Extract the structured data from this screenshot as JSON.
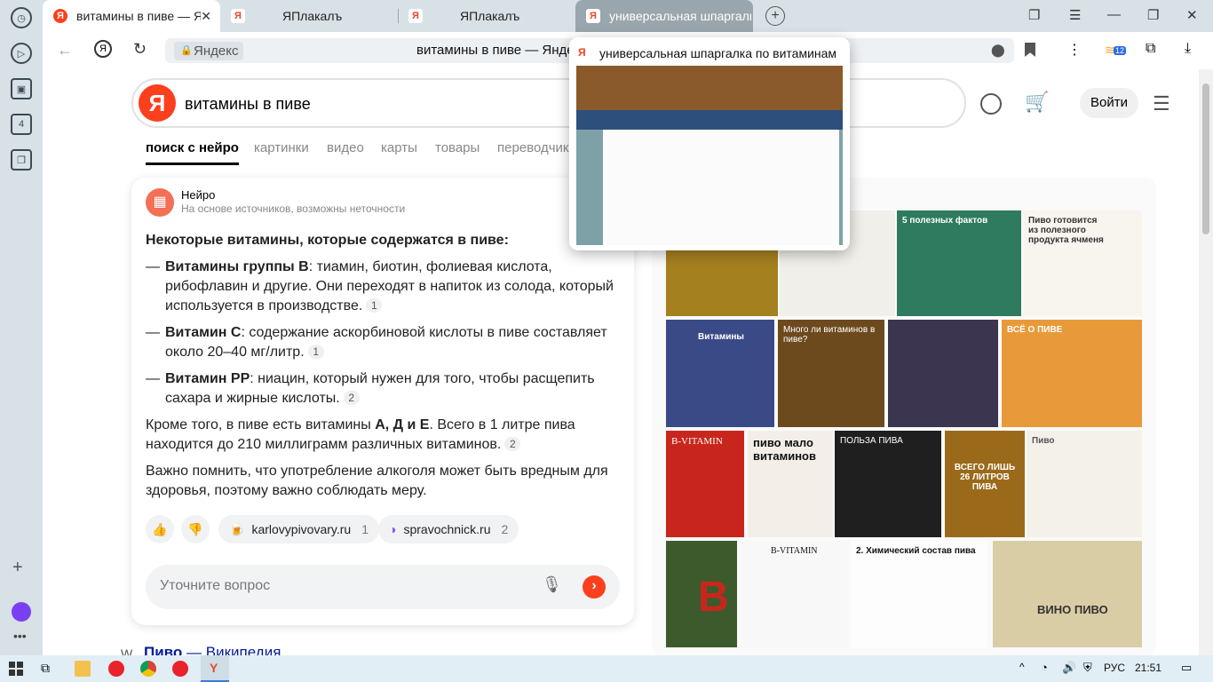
{
  "tabs": [
    {
      "label": "витамины в пиве — Яндекс"
    },
    {
      "label": "ЯПлакалъ"
    },
    {
      "label": "ЯПлакалъ"
    },
    {
      "label": "универсальная шпаргалка"
    }
  ],
  "addressbar": {
    "domain": "Яндекс",
    "title": "витамины в пиве — Яндекс"
  },
  "extension_badge": "12",
  "sidebar_badge": "4",
  "search": {
    "query": "витамины в пиве",
    "login": "Войти"
  },
  "nav": [
    "поиск с нейро",
    "картинки",
    "видео",
    "карты",
    "товары",
    "переводчик"
  ],
  "neuro": {
    "name": "Нейро",
    "subtitle": "На основе источников, возможны неточности",
    "heading": "Некоторые витамины, которые содержатся в пиве:",
    "items": [
      {
        "bold": "Витамины группы В",
        "text": ": тиамин, биотин, фолиевая кислота, рибофлавин и другие. Они переходят в напиток из солода, который используется в производстве.",
        "ref": "1"
      },
      {
        "bold": "Витамин С",
        "text": ": содержание аскорбиновой кислоты в пиве составляет около 20–40 мг/литр.",
        "ref": "1"
      },
      {
        "bold": "Витамин РР",
        "text": ": ниацин, который нужен для того, чтобы расщепить сахара и жирные кислоты.",
        "ref": "2"
      }
    ],
    "p1_a": "Кроме того, в пиве есть витамины ",
    "p1_bold": "А, Д и Е",
    "p1_b": ". Всего в 1 литре пива находится до 210 миллиграмм различных витаминов.",
    "p1_ref": "2",
    "p2": "Важно помнить, что употребление алкоголя может быть вредным для здоровья, поэтому важно соблюдать меру.",
    "sources": [
      {
        "name": "karlovypivovary.ru",
        "count": "1"
      },
      {
        "name": "spravochnick.ru",
        "count": "2"
      }
    ],
    "ask_placeholder": "Уточните вопрос"
  },
  "wiki": {
    "title": "Пиво",
    "site": "Википедия"
  },
  "images": [
    {
      "cap": "",
      "color": "#a5801f"
    },
    {
      "cap": "",
      "color": "#f0efe9"
    },
    {
      "cap": "5 полезных фактов",
      "color": "#2f7b5f"
    },
    {
      "cap": "Пиво готовится из полезного продукта ячменя",
      "color": "#f8f4ee"
    },
    {
      "cap": "Витамины",
      "color": "#3a4a86"
    },
    {
      "cap": "Много ли витаминов в пиве?",
      "color": "#6d4a1e"
    },
    {
      "cap": "",
      "color": "#3b3550"
    },
    {
      "cap": "ВСЁ О ПИВЕ",
      "color": "#e89a3a"
    },
    {
      "cap": "B-VITAMIN",
      "color": "#c8261d"
    },
    {
      "cap": "пиво мало витаминов",
      "color": "#f3efe8"
    },
    {
      "cap": "ПОЛЬЗА ПИВА",
      "color": "#1f1f1f"
    },
    {
      "cap": "ВСЕГО ЛИШЬ 26 ЛИТРОВ ПИВА",
      "color": "#9a6a1a"
    },
    {
      "cap": "Пиво",
      "color": "#f4f1ea"
    },
    {
      "cap": "",
      "color": "#3d5a2c"
    },
    {
      "cap": "B-VITAMIN",
      "color": "#f8f8f8"
    },
    {
      "cap": "2. Химический состав пива",
      "color": "#fdfdfd"
    },
    {
      "cap": "ВИНО ПИВО",
      "color": "#d9cda6"
    }
  ],
  "preview": {
    "title": "универсальная шпаргалка по витаминам — ЯПлакалъ"
  },
  "taskbar": {
    "lang": "РУС",
    "time": "21:51"
  }
}
